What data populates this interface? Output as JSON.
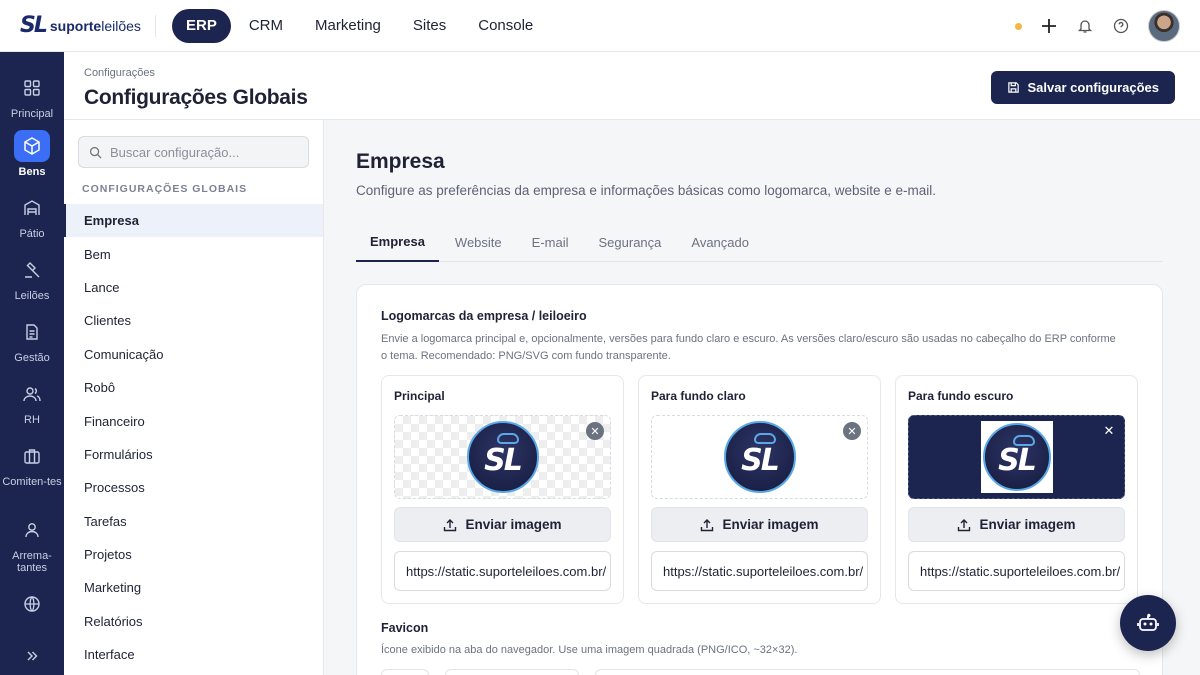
{
  "brand": {
    "mark": "SL",
    "name_bold": "suporte",
    "name_light": "leilões"
  },
  "topnav": [
    {
      "label": "ERP",
      "active": true
    },
    {
      "label": "CRM",
      "active": false
    },
    {
      "label": "Marketing",
      "active": false
    },
    {
      "label": "Sites",
      "active": false
    },
    {
      "label": "Console",
      "active": false
    }
  ],
  "colors": {
    "primary": "#1b2550",
    "accent": "#3b6ef5",
    "status_dot": "#f5b642"
  },
  "rail": [
    {
      "label": "Principal",
      "icon": "grid-icon"
    },
    {
      "label": "Bens",
      "icon": "box-icon",
      "active": true
    },
    {
      "label": "Pátio",
      "icon": "warehouse-icon"
    },
    {
      "label": "Leilões",
      "icon": "gavel-icon"
    },
    {
      "label": "Gestão",
      "icon": "document-icon"
    },
    {
      "label": "RH",
      "icon": "users-icon"
    },
    {
      "label": "Comiten-tes",
      "icon": "briefcase-icon"
    },
    {
      "label": "Arrema-tantes",
      "icon": "user-icon"
    },
    {
      "label": "",
      "icon": "globe-icon"
    }
  ],
  "header": {
    "breadcrumb": "Configurações",
    "title": "Configurações Globais",
    "save_label": "Salvar configurações"
  },
  "sidebar": {
    "search_placeholder": "Buscar configuração...",
    "section_label": "CONFIGURAÇÕES GLOBAIS",
    "items": [
      "Empresa",
      "Bem",
      "Lance",
      "Clientes",
      "Comunicação",
      "Robô",
      "Financeiro",
      "Formulários",
      "Processos",
      "Tarefas",
      "Projetos",
      "Marketing",
      "Relatórios",
      "Interface"
    ]
  },
  "section": {
    "title": "Empresa",
    "description": "Configure as preferências da empresa e informações básicas como logomarca, website e e-mail.",
    "tabs": [
      "Empresa",
      "Website",
      "E-mail",
      "Segurança",
      "Avançado"
    ]
  },
  "logos": {
    "title": "Logomarcas da empresa / leiloeiro",
    "description": "Envie a logomarca principal e, opcionalmente, versões para fundo claro e escuro. As versões claro/escuro são usadas no cabeçalho do ERP conforme o tema. Recomendado: PNG/SVG com fundo transparente.",
    "cards": [
      {
        "title": "Principal",
        "upload_label": "Enviar imagem",
        "url": "https://static.suporteleiloes.com.br/"
      },
      {
        "title": "Para fundo claro",
        "upload_label": "Enviar imagem",
        "url": "https://static.suporteleiloes.com.br/"
      },
      {
        "title": "Para fundo escuro",
        "upload_label": "Enviar imagem",
        "url": "https://static.suporteleiloes.com.br/"
      }
    ]
  },
  "favicon": {
    "title": "Favicon",
    "description": "Ícone exibido na aba do navegador. Use uma imagem quadrada (PNG/ICO, ~32×32)."
  }
}
